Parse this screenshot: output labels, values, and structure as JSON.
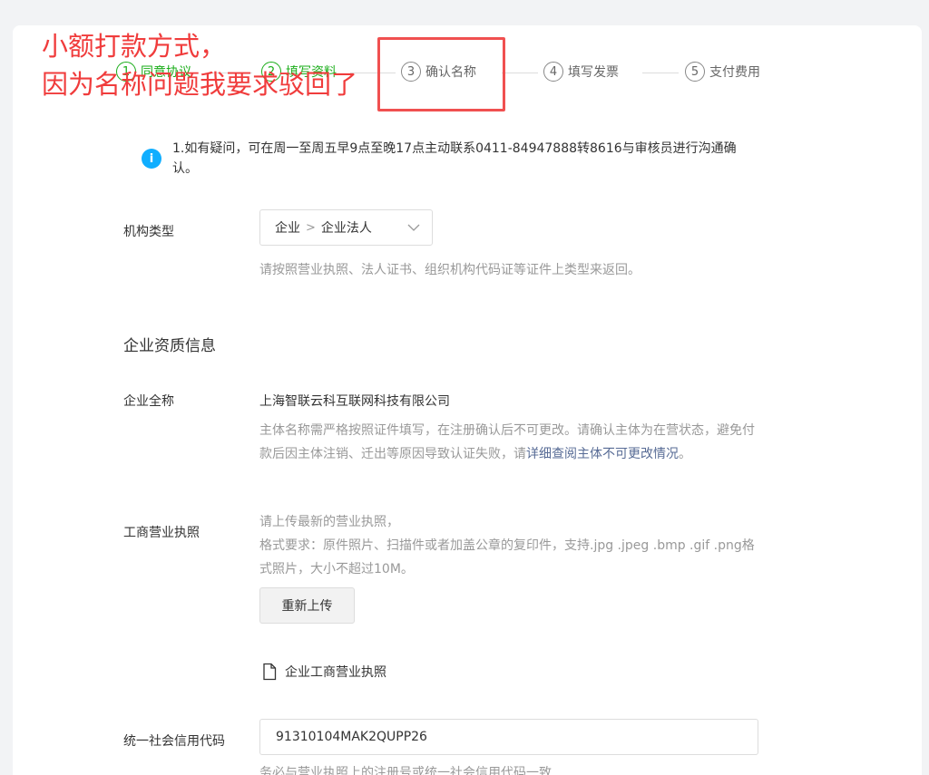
{
  "steps": [
    {
      "num": "1",
      "label": "同意协议",
      "state": "done"
    },
    {
      "num": "2",
      "label": "填写资料",
      "state": "active"
    },
    {
      "num": "3",
      "label": "确认名称",
      "state": "pending"
    },
    {
      "num": "4",
      "label": "填写发票",
      "state": "pending"
    },
    {
      "num": "5",
      "label": "支付费用",
      "state": "pending"
    }
  ],
  "annotation": {
    "line1": "小额打款方式，",
    "line2": "因为名称问题我要求驳回了",
    "color": "#f03c3c"
  },
  "notice": {
    "icon": "info-icon",
    "text": "1.如有疑问，可在周一至周五早9点至晚17点主动联系0411-84947888转8616与审核员进行沟通确认。"
  },
  "org_type": {
    "label": "机构类型",
    "level1": "企业",
    "level2": "企业法人",
    "hint": "请按照营业执照、法人证书、组织机构代码证等证件上类型来返回。"
  },
  "section_title": "企业资质信息",
  "company_name": {
    "label": "企业全称",
    "value": "上海智联云科互联网科技有限公司",
    "hint_prefix": "主体名称需严格按照证件填写，在注册确认后不可更改。请确认主体为在营状态，避免付款后因主体注销、迁出等原因导致认证失败，请",
    "hint_link": "详细查阅主体不可更改情况",
    "hint_suffix": "。"
  },
  "license": {
    "label": "工商营业执照",
    "hint_line1": "请上传最新的营业执照，",
    "hint_line2": "格式要求：原件照片、扫描件或者加盖公章的复印件，支持.jpg .jpeg .bmp .gif .png格式照片，大小不超过10M。",
    "reupload_button": "重新上传",
    "file_name": "企业工商营业执照"
  },
  "credit_code": {
    "label": "统一社会信用代码",
    "value": "91310104MAK2QUPP26",
    "hint": "务必与营业执照上的注册号或统一社会信用代码一致"
  }
}
